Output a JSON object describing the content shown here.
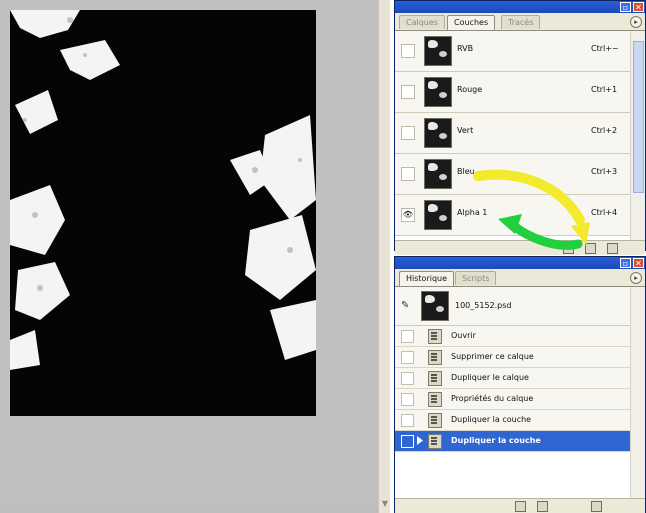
{
  "channels_palette": {
    "tabs": [
      "Calques",
      "Couches",
      "Tracés"
    ],
    "active_tab": "Couches",
    "rows": [
      {
        "name": "RVB",
        "shortcut": "Ctrl+~",
        "visible": false
      },
      {
        "name": "Rouge",
        "shortcut": "Ctrl+1",
        "visible": false
      },
      {
        "name": "Vert",
        "shortcut": "Ctrl+2",
        "visible": false
      },
      {
        "name": "Bleu",
        "shortcut": "Ctrl+3",
        "visible": false
      },
      {
        "name": "Alpha 1",
        "shortcut": "Ctrl+4",
        "visible": true
      }
    ]
  },
  "history_palette": {
    "tabs": [
      "Historique",
      "Scripts"
    ],
    "active_tab": "Historique",
    "snapshot": "100_5152.psd",
    "states": [
      "Ouvrir",
      "Supprimer ce calque",
      "Dupliquer le calque",
      "Propriétés du calque",
      "Dupliquer la couche",
      "Dupliquer la couche"
    ],
    "selected_state": 5
  },
  "colors": {
    "titlebar": "#2a5fd6",
    "selection": "#2f66d1",
    "annotation_yellow": "#f3ea2c",
    "annotation_green": "#22cf3d"
  }
}
